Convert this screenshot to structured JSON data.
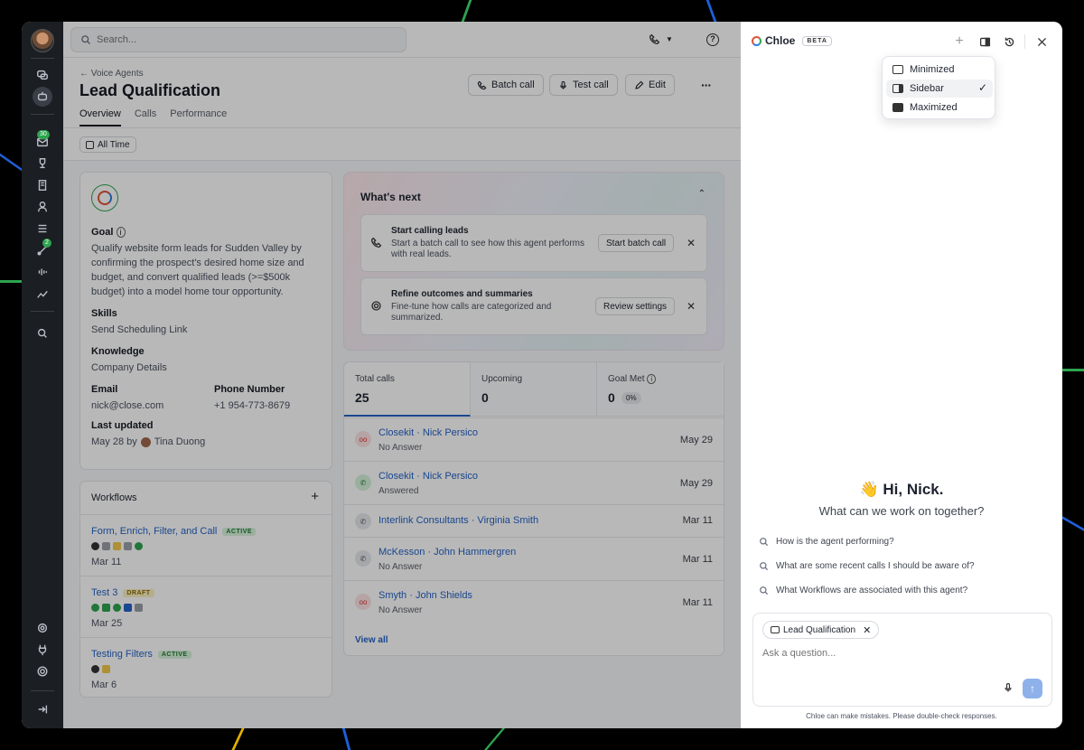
{
  "search": {
    "placeholder": "Search..."
  },
  "rail": {
    "badge_inbox": "30",
    "badge_tasks": "2"
  },
  "header": {
    "breadcrumb": "← Voice Agents",
    "title": "Lead Qualification",
    "tabs": [
      {
        "label": "Overview"
      },
      {
        "label": "Calls"
      },
      {
        "label": "Performance"
      }
    ],
    "buttons": {
      "batch_call": "Batch call",
      "test_call": "Test call",
      "edit": "Edit",
      "more": "···"
    }
  },
  "filter": {
    "label": "All Time"
  },
  "agent": {
    "goal_label": "Goal",
    "goal_text": "Qualify website form leads for Sudden Valley by confirming the prospect's desired home size and budget, and convert qualified leads (>=$500k budget) into a model home tour opportunity.",
    "skills_label": "Skills",
    "skills_value": "Send Scheduling Link",
    "knowledge_label": "Knowledge",
    "knowledge_value": "Company Details",
    "email_label": "Email",
    "email_value": "nick@close.com",
    "phone_label": "Phone Number",
    "phone_value": "+1 954-773-8679",
    "updated_label": "Last updated",
    "updated_prefix": "May 28 by",
    "updated_user": "Tina Duong"
  },
  "workflows": {
    "title": "Workflows",
    "add": "+",
    "items": [
      {
        "name": "Form, Enrich, Filter, and Call",
        "status": "ACTIVE",
        "date": "Mar 11"
      },
      {
        "name": "Test 3",
        "status": "DRAFT",
        "date": "Mar 25"
      },
      {
        "name": "Testing Filters",
        "status": "ACTIVE",
        "date": "Mar 6"
      }
    ]
  },
  "whats_next": {
    "title": "What's next",
    "items": [
      {
        "title": "Start calling leads",
        "desc": "Start a batch call to see how this agent performs with real leads.",
        "button": "Start batch call"
      },
      {
        "title": "Refine outcomes and summaries",
        "desc": "Fine-tune how calls are categorized and summarized.",
        "button": "Review settings"
      }
    ]
  },
  "stats": {
    "total_label": "Total calls",
    "total_value": "25",
    "upcoming_label": "Upcoming",
    "upcoming_value": "0",
    "goal_label": "Goal Met",
    "goal_value": "0",
    "goal_pct": "0%"
  },
  "calls": {
    "items": [
      {
        "name": "Closekit · Nick Persico",
        "status": "No Answer",
        "date": "May 29"
      },
      {
        "name": "Closekit · Nick Persico",
        "status": "Answered",
        "date": "May 29"
      },
      {
        "name": "Interlink Consultants · Virginia Smith",
        "status": "",
        "date": "Mar 11"
      },
      {
        "name": "McKesson · John Hammergren",
        "status": "No Answer",
        "date": "Mar 11"
      },
      {
        "name": "Smyth · John Shields",
        "status": "No Answer",
        "date": "Mar 11"
      }
    ],
    "view_all": "View all"
  },
  "chloe": {
    "name": "Chloe",
    "beta": "BETA",
    "menu": [
      {
        "label": "Minimized"
      },
      {
        "label": "Sidebar",
        "check": "✓"
      },
      {
        "label": "Maximized"
      }
    ],
    "greeting": "👋 Hi, Nick.",
    "subgreeting": "What can we work on together?",
    "suggestions": [
      "How is the agent performing?",
      "What are some recent calls I should be aware of?",
      "What Workflows are associated with this agent?"
    ],
    "context_chip": "Lead Qualification",
    "input_placeholder": "Ask a question...",
    "disclaimer": "Chloe can make mistakes. Please double-check responses."
  }
}
